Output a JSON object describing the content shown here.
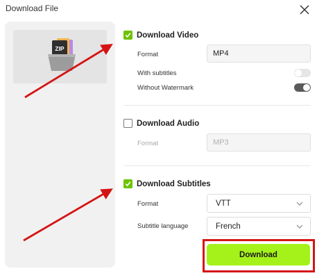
{
  "dialog": {
    "title": "Download File"
  },
  "video": {
    "label": "Download Video",
    "checked": true,
    "format_label": "Format",
    "format_value": "MP4",
    "subtitles_label": "With subtitles",
    "subtitles_on": false,
    "watermark_label": "Without Watermark",
    "watermark_on": true
  },
  "audio": {
    "label": "Download Audio",
    "checked": false,
    "format_label": "Format",
    "format_value": "MP3"
  },
  "subtitles": {
    "label": "Download Subtitles",
    "checked": true,
    "format_label": "Format",
    "format_value": "VTT",
    "language_label": "Subtitle language",
    "language_value": "French"
  },
  "thumbnail": {
    "badge": "ZIP"
  },
  "actions": {
    "download_label": "Download"
  },
  "colors": {
    "accent_green": "#6cc300",
    "download_button": "#a5f21a",
    "annotation_red": "#d41414"
  },
  "icons": [
    "close-icon",
    "zip-file-icon",
    "checkmark-icon",
    "chevron-down-icon"
  ]
}
